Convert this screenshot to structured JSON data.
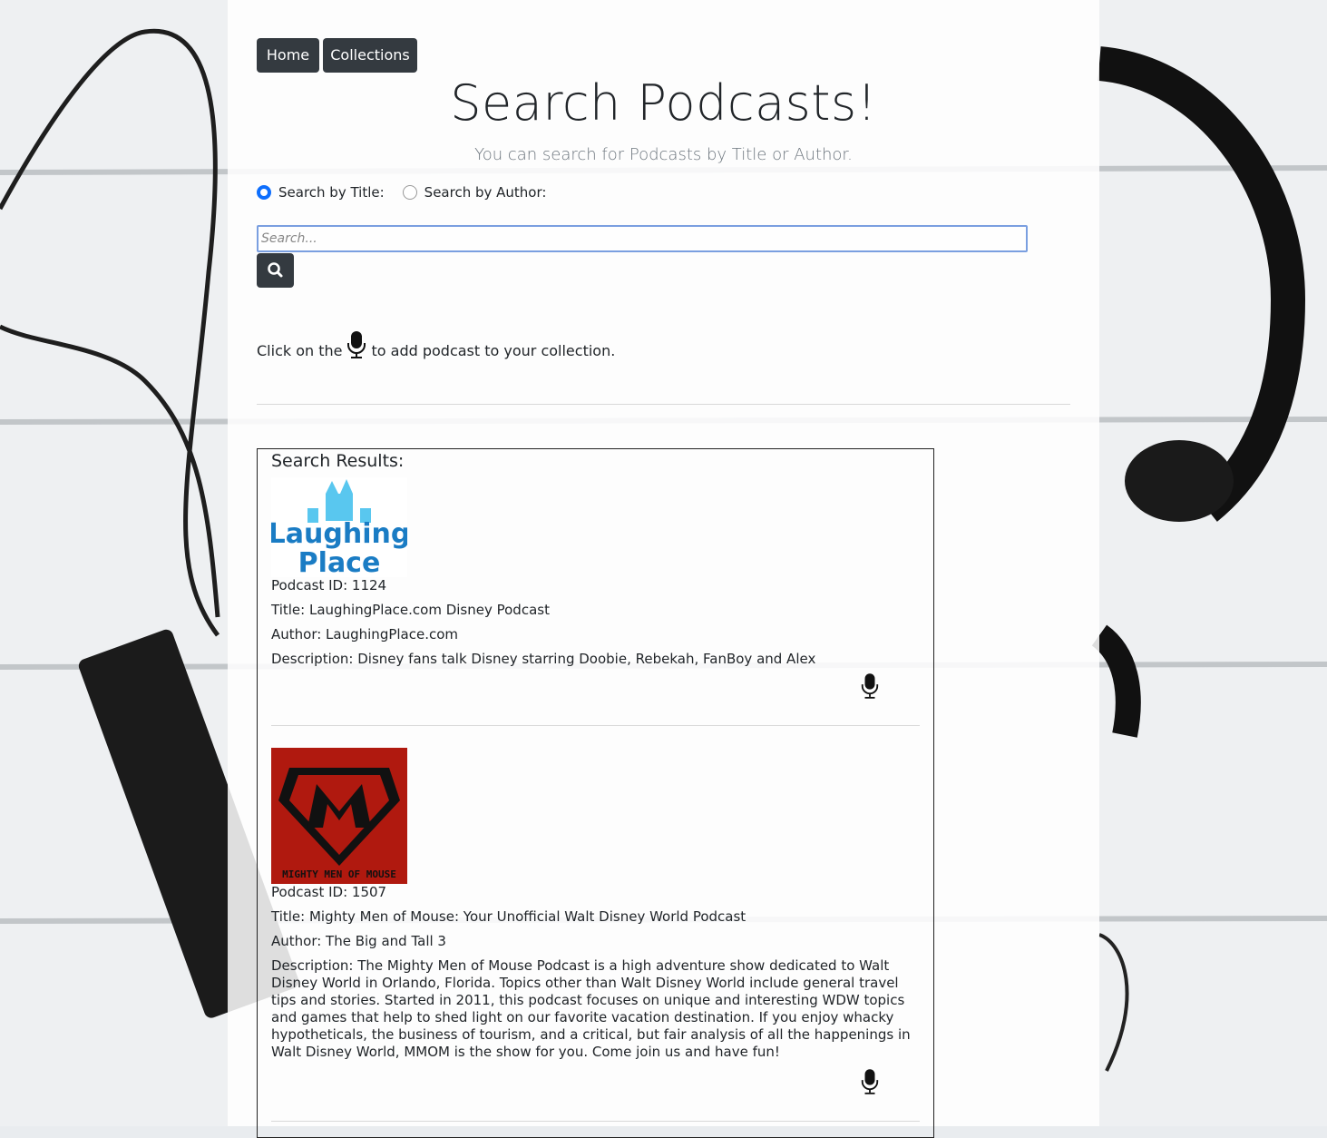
{
  "nav": {
    "home_label": "Home",
    "collections_label": "Collections"
  },
  "header": {
    "title": "Search Podcasts!",
    "subtitle": "You can search for Podcasts by Title or Author."
  },
  "search": {
    "by_title_label": "Search by Title:",
    "by_author_label": "Search by Author:",
    "selected": "title",
    "placeholder": "Search...",
    "value": ""
  },
  "hint": {
    "before": "Click on the",
    "after": "to add podcast to your collection."
  },
  "results": {
    "title": "Search Results:",
    "items": [
      {
        "logo_text_1": "Laughing",
        "logo_text_2": "Place",
        "id": "Podcast ID: 1124",
        "title": "Title: LaughingPlace.com Disney Podcast",
        "author": "Author: LaughingPlace.com",
        "description": "Description: Disney fans talk Disney starring Doobie, Rebekah, FanBoy and Alex"
      },
      {
        "logo_text_1": "MIGHTY MEN OF MOUSE",
        "id": "Podcast ID: 1507",
        "title": "Title: Mighty Men of Mouse: Your Unofficial Walt Disney World Podcast",
        "author": "Author: The Big and Tall 3",
        "description": "Description: The Mighty Men of Mouse Podcast is a high adventure show dedicated to Walt Disney World in Orlando, Florida. Topics other than Walt Disney World include general travel tips and stories. Started in 2011, this podcast focuses on unique and interesting WDW topics and games that help to shed light on our favorite vacation destination. If you enjoy whacky hypotheticals, the business of tourism, and a critical, but fair analysis of all the happenings in Walt Disney World, MMOM is the show for you. Come join us and have fun!"
      }
    ]
  },
  "colors": {
    "button_dark": "#343a40",
    "radio_active": "#0d6efd",
    "laughing_blue": "#1a7cc4",
    "mmom_red": "#b0190f"
  }
}
